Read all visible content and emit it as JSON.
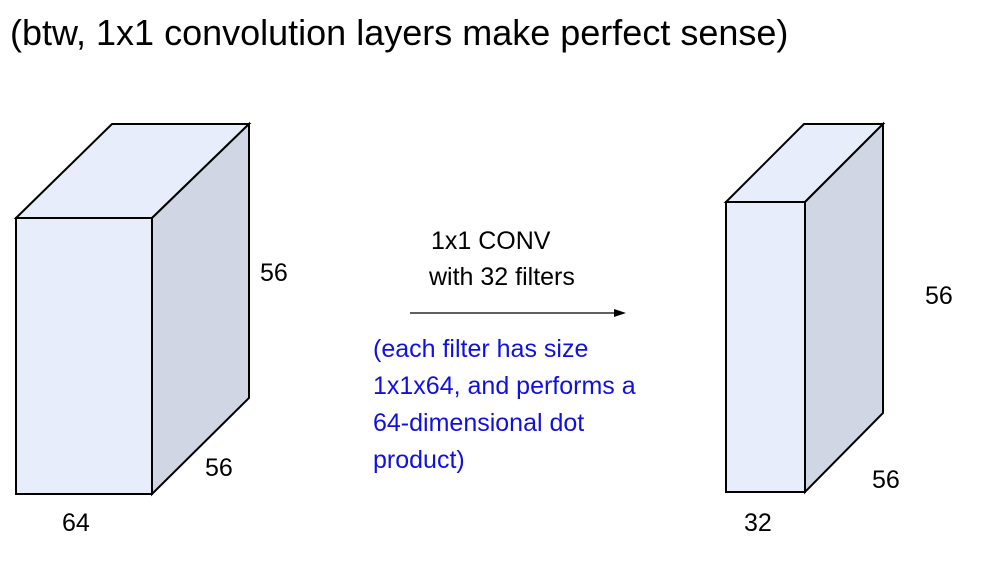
{
  "title": "(btw, 1x1 convolution layers make perfect sense)",
  "input_volume": {
    "height_label": "56",
    "depth_label": "56",
    "width_label": "64"
  },
  "output_volume": {
    "height_label": "56",
    "depth_label": "56",
    "width_label": "32"
  },
  "operation": {
    "line1": "1x1 CONV",
    "line2": "with 32 filters"
  },
  "note": {
    "lines": [
      "(each filter has size",
      "1x1x64, and performs a",
      "64-dimensional dot",
      "product)"
    ]
  },
  "colors": {
    "front_face": "#e8edfb",
    "side_face": "#d0d6e4",
    "top_face": "#e8edfb",
    "outline": "#000000",
    "note_text": "#1010e0"
  }
}
